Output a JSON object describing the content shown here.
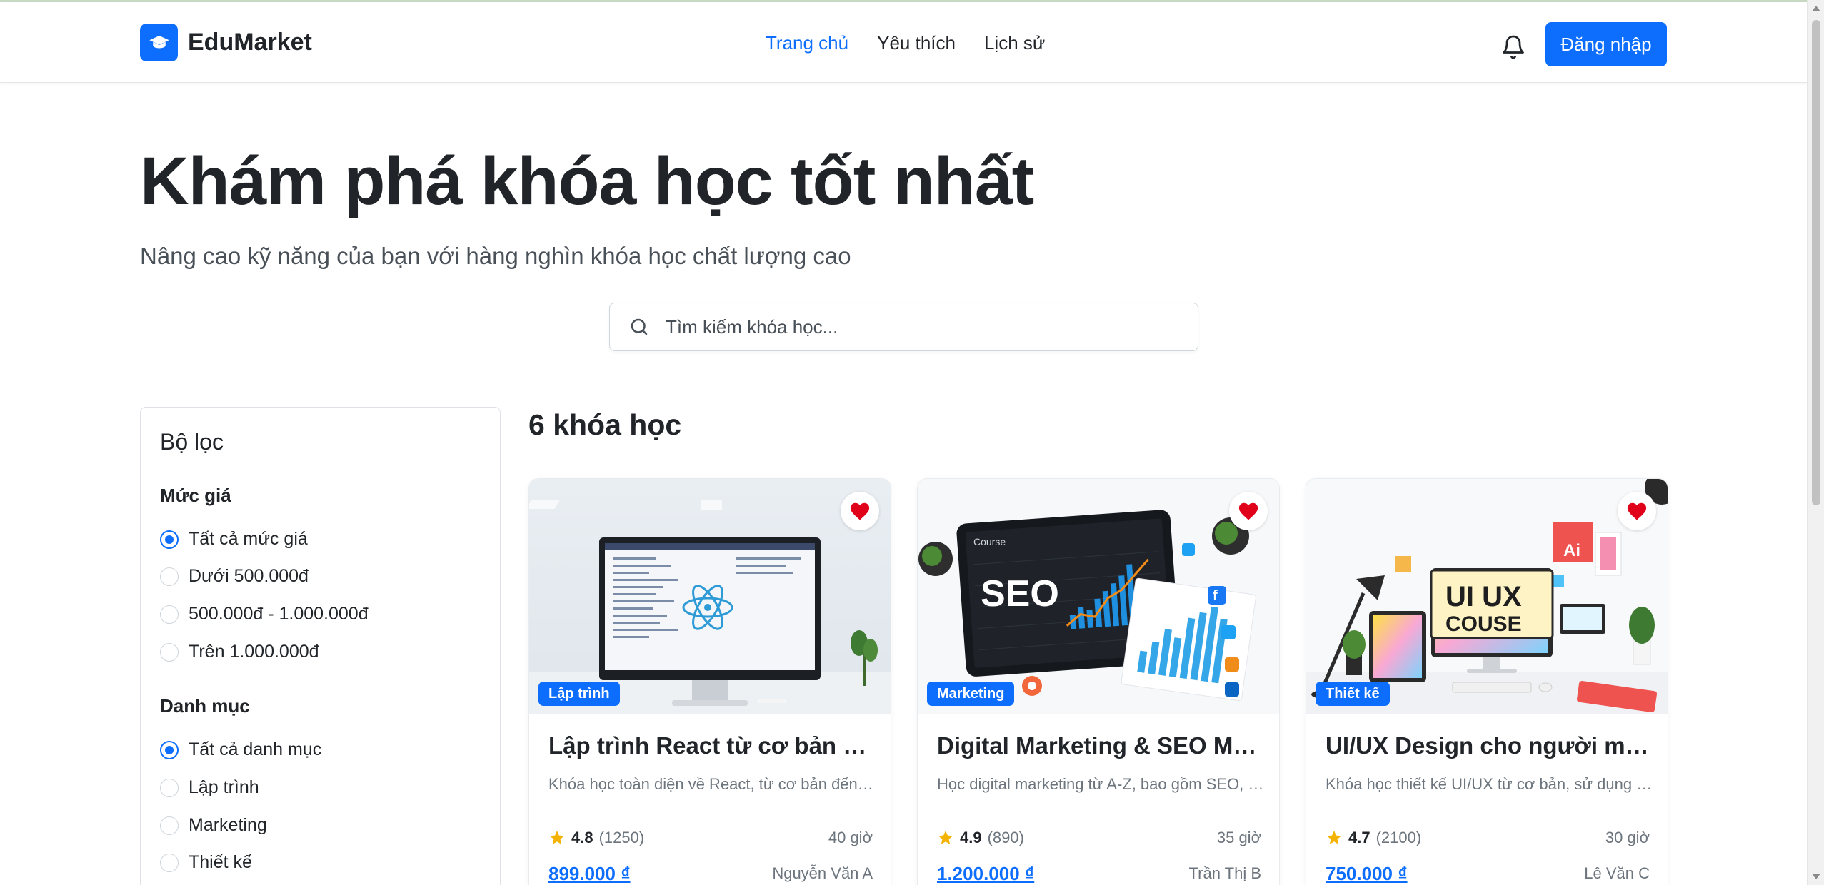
{
  "brand": {
    "name": "EduMarket",
    "logo_icon": "graduation-cap-icon"
  },
  "nav": {
    "links": [
      {
        "label": "Trang chủ",
        "active": true
      },
      {
        "label": "Yêu thích",
        "active": false
      },
      {
        "label": "Lịch sử",
        "active": false
      }
    ],
    "bell_icon": "bell-icon",
    "login_label": "Đăng nhập"
  },
  "hero": {
    "title": "Khám phá khóa học tốt nhất",
    "subtitle": "Nâng cao kỹ năng của bạn với hàng nghìn khóa học chất lượng cao"
  },
  "search": {
    "placeholder": "Tìm kiếm khóa học..."
  },
  "filters": {
    "title": "Bộ lọc",
    "price": {
      "title": "Mức giá",
      "options": [
        "Tất cả mức giá",
        "Dưới 500.000đ",
        "500.000đ - 1.000.000đ",
        "Trên 1.000.000đ"
      ],
      "selected": 0
    },
    "category": {
      "title": "Danh mục",
      "options": [
        "Tất cả danh mục",
        "Lập trình",
        "Marketing",
        "Thiết kế"
      ],
      "selected": 0
    }
  },
  "results": {
    "count_label": "6 khóa học",
    "courses": [
      {
        "badge": "Lập trình",
        "title": "Lập trình React từ cơ bản đến nâng cao",
        "description": "Khóa học toàn diện về React, từ cơ bản đến nâng cao",
        "rating": "4.8",
        "reviews": "(1250)",
        "hours": "40 giờ",
        "price": "899.000 ₫",
        "author": "Nguyễn Văn A",
        "favorited": true
      },
      {
        "badge": "Marketing",
        "title": "Digital Marketing & SEO Master",
        "description": "Học digital marketing từ A-Z, bao gồm SEO, SEM",
        "rating": "4.9",
        "reviews": "(890)",
        "hours": "35 giờ",
        "price": "1.200.000 ₫",
        "author": "Trần Thị B",
        "favorited": true,
        "image_text": {
          "label": "Course",
          "big": "SEO"
        }
      },
      {
        "badge": "Thiết kế",
        "title": "UI/UX Design cho người mới bắt đầu",
        "description": "Khóa học thiết kế UI/UX từ cơ bản, sử dụng Figma",
        "rating": "4.7",
        "reviews": "(2100)",
        "hours": "30 giờ",
        "price": "750.000 ₫",
        "author": "Lê Văn C",
        "favorited": true,
        "image_text": {
          "line1": "UI UX",
          "line2": "COUSE"
        }
      }
    ]
  },
  "colors": {
    "primary": "#0d6efd",
    "text": "#212529",
    "muted": "#6c757d",
    "heart": "#e0001a",
    "star": "#f5b301"
  }
}
